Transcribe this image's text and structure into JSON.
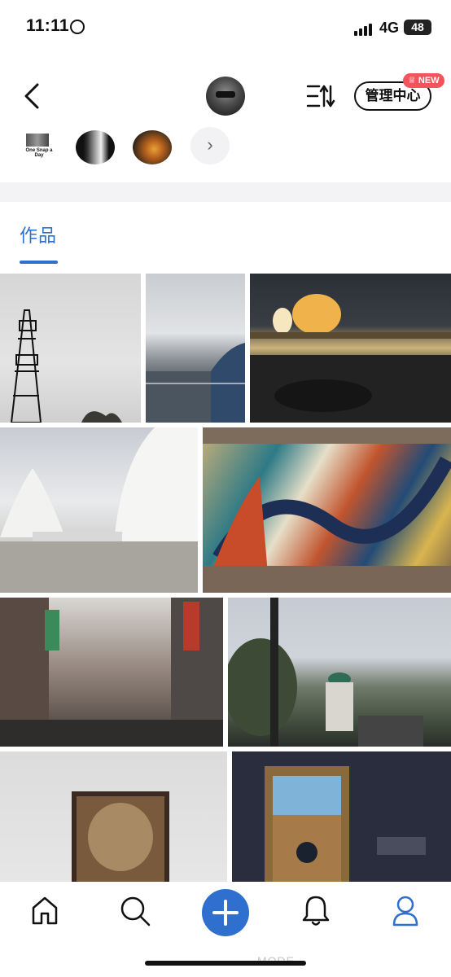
{
  "status_bar": {
    "time": "11:11",
    "network": "4G",
    "battery": "48"
  },
  "header": {
    "manage_label": "管理中心",
    "new_badge": "NEW"
  },
  "stories": {
    "first_caption": "One Snap a Day"
  },
  "tabs": [
    {
      "label": "作品",
      "active": true
    }
  ],
  "photos": [
    {
      "subject": "transmission tower under grey sky"
    },
    {
      "subject": "coastal road with sea and pier"
    },
    {
      "subject": "glowing dome at night by the sea"
    },
    {
      "subject": "white shell opera house with crowd"
    },
    {
      "subject": "colourful mosaic wall"
    },
    {
      "subject": "old street with shop signs"
    },
    {
      "subject": "trees and domed building"
    },
    {
      "subject": "portrait painting on gallery wall"
    },
    {
      "subject": "framed painting on dark wall"
    }
  ],
  "bottom_nav": {
    "items": [
      {
        "icon": "home-icon",
        "active": false
      },
      {
        "icon": "search-icon",
        "active": false
      },
      {
        "icon": "plus-icon",
        "active": false
      },
      {
        "icon": "bell-icon",
        "active": false
      },
      {
        "icon": "profile-icon",
        "active": true
      }
    ]
  },
  "watermark": "MODE",
  "colors": {
    "accent": "#2f6fce",
    "badge": "#f2545b",
    "text": "#111111",
    "separator": "#f3f3f5"
  }
}
